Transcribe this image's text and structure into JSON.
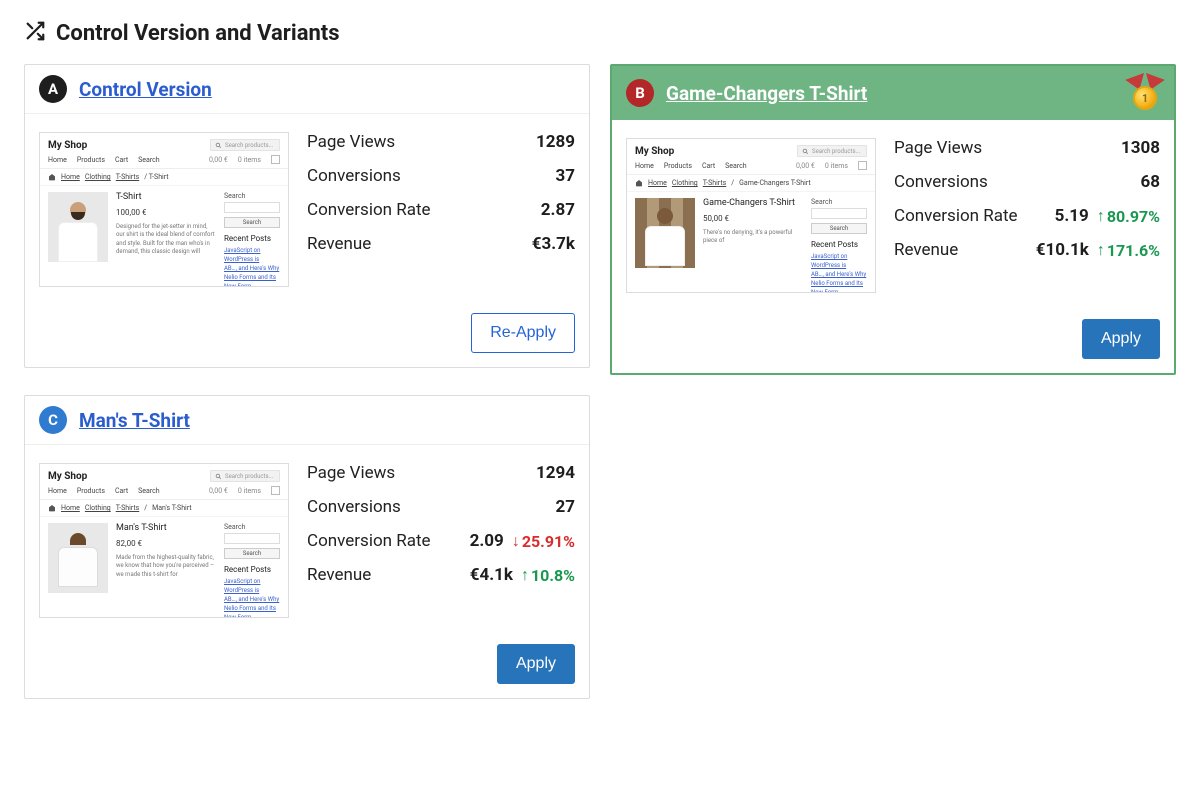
{
  "header": {
    "title": "Control Version and Variants"
  },
  "metric_labels": {
    "views": "Page Views",
    "conversions": "Conversions",
    "rate": "Conversion Rate",
    "revenue": "Revenue"
  },
  "thumb": {
    "brand": "My Shop",
    "search_placeholder": "Search products...",
    "nav": {
      "home": "Home",
      "products": "Products",
      "cart": "Cart",
      "search": "Search",
      "total": "0,00 €",
      "items": "0 items"
    },
    "crumb": {
      "home": "Home",
      "clothing": "Clothing",
      "tshirts": "T-Shirts"
    },
    "sidebar": {
      "search_label": "Search",
      "search_btn": "Search",
      "recent_heading": "Recent Posts",
      "recent1": "JavaScript on WordPress is",
      "recent2": "AB…, and Here's Why",
      "recent3": "Nelio Forms and Its New Form"
    }
  },
  "variants": {
    "a": {
      "badge": "A",
      "title": "Control Version",
      "product": {
        "title": "T-Shirt",
        "price": "100,00 €",
        "desc": "Designed for the jet-setter in mind, our shirt is the ideal blend of comfort and style. Built for the man who's in demand, this classic design will"
      },
      "metrics": {
        "views": "1289",
        "conversions": "37",
        "rate": "2.87",
        "revenue": "€3.7k"
      },
      "button": "Re-Apply"
    },
    "b": {
      "badge": "B",
      "title": "Game-Changers T-Shirt",
      "crumb_extra": "Game-Changers T-Shirt",
      "product": {
        "title": "Game-Changers T-Shirt",
        "price": "50,00 €",
        "desc": "There's no denying, it's a powerful piece of"
      },
      "metrics": {
        "views": "1308",
        "conversions": "68",
        "rate": "5.19",
        "revenue": "€10.1k",
        "rate_delta": "80.97%",
        "revenue_delta": "171.6%"
      },
      "button": "Apply"
    },
    "c": {
      "badge": "C",
      "title": "Man's T-Shirt",
      "crumb_extra": "Man's T-Shirt",
      "product": {
        "title": "Man's T-Shirt",
        "price": "82,00 €",
        "desc": "Made from the highest-quality fabric, we know that how you're perceived – we made this t-shirt for"
      },
      "metrics": {
        "views": "1294",
        "conversions": "27",
        "rate": "2.09",
        "revenue": "€4.1k",
        "rate_delta": "25.91%",
        "revenue_delta": "10.8%"
      },
      "button": "Apply"
    }
  }
}
